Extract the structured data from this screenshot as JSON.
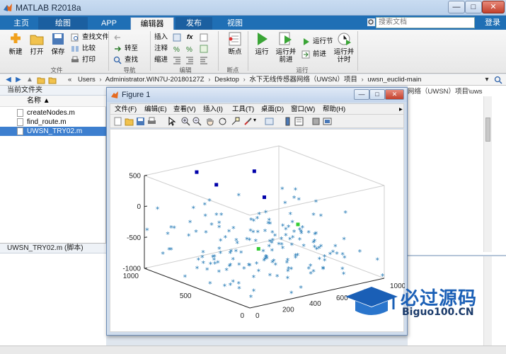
{
  "window": {
    "title": "MATLAB R2018a",
    "min": "—",
    "max": "□",
    "close": "✕"
  },
  "tabs": [
    {
      "label": "主页"
    },
    {
      "label": "绘图"
    },
    {
      "label": "APP"
    },
    {
      "label": "编辑器"
    },
    {
      "label": "发布"
    },
    {
      "label": "视图"
    }
  ],
  "search": {
    "placeholder": "搜索文档"
  },
  "signin_label": "登录",
  "ribbon": {
    "file": {
      "new": "新建",
      "open": "打开",
      "save": "保存",
      "find_files": "查找文件",
      "compare": "比较",
      "print": "打印",
      "group": "文件"
    },
    "nav": {
      "goto": "转至",
      "find": "查找",
      "group": "导航"
    },
    "edit": {
      "insert": "插入",
      "comment": "注释",
      "indent": "缩进",
      "fx": "fx",
      "group": "编辑"
    },
    "breakpoints": {
      "label": "断点",
      "group": "断点"
    },
    "run": {
      "run": "运行",
      "run_advance": "运行并\n前进",
      "run_section": "运行节",
      "advance": "前进",
      "run_time": "运行并\n计时",
      "group": "运行"
    }
  },
  "address": {
    "prefix": "«",
    "path": [
      "Users",
      "Administrator.WIN7U-20180127Z",
      "Desktop",
      "水下无线传感器网络（UWSN）项目",
      "uwsn_euclid-main"
    ]
  },
  "left_panel": {
    "header": "当前文件夹",
    "column": "名称 ▲",
    "files": [
      {
        "name": "createNodes.m",
        "selected": false
      },
      {
        "name": "find_route.m",
        "selected": false
      },
      {
        "name": "UWSN_TRY02.m",
        "selected": true
      }
    ],
    "details_title": "UWSN_TRY02.m  (脚本)"
  },
  "right_panel": {
    "title_fragment": "网络（UWSN）项目\\uws"
  },
  "figure": {
    "title": "Figure 1",
    "menus": [
      "文件(F)",
      "编辑(E)",
      "查看(V)",
      "插入(I)",
      "工具(T)",
      "桌面(D)",
      "窗口(W)",
      "帮助(H)"
    ]
  },
  "chart_data": {
    "type": "scatter3d",
    "zticks": [
      "500",
      "0",
      "-500",
      "-1000"
    ],
    "yticks": [
      "1000",
      "500",
      "0"
    ],
    "xticks": [
      "0",
      "200",
      "400",
      "600",
      "800",
      "1000"
    ],
    "zlim": [
      -1000,
      500
    ],
    "xlim": [
      0,
      1000
    ],
    "ylim": [
      0,
      1000
    ],
    "series": [
      {
        "marker": "*",
        "color": "#1f77b4"
      },
      {
        "marker": "square",
        "color": "#0000aa"
      },
      {
        "marker": "square",
        "color": "#33cc33"
      }
    ],
    "grid": false
  },
  "watermark": {
    "title": "必过源码",
    "subtitle": "Biguo100.CN"
  },
  "colors": {
    "accent": "#1f6fb5",
    "selection": "#3d7fcf",
    "marker": "#1f77b4"
  }
}
